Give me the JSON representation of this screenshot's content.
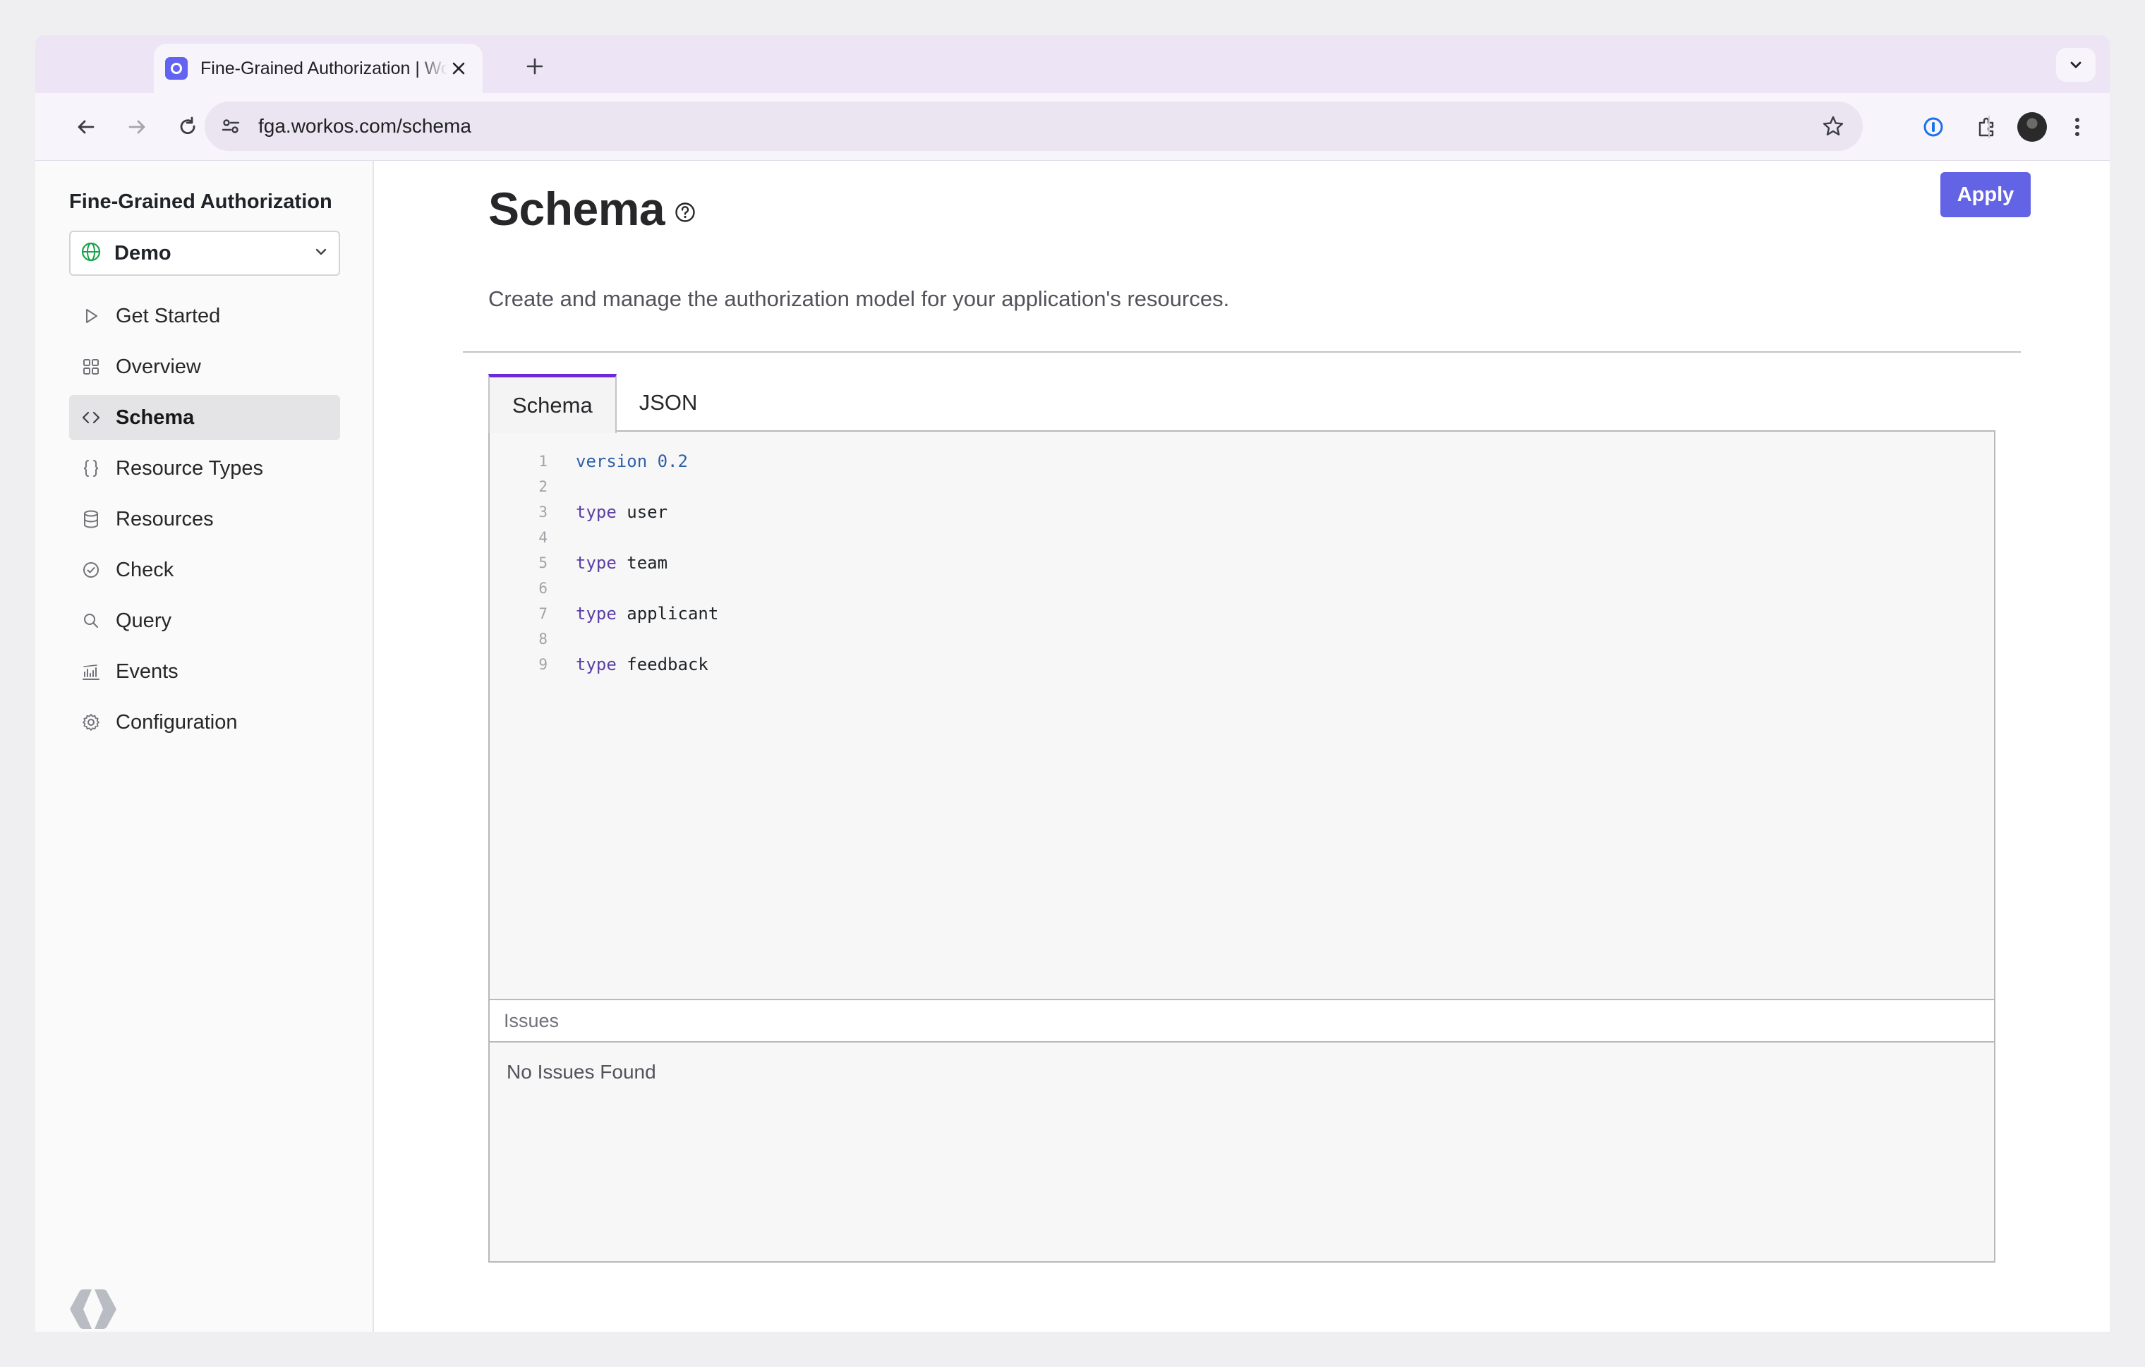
{
  "browser": {
    "tab_title": "Fine-Grained Authorization | WorkOS",
    "url": "fga.workos.com/schema"
  },
  "sidebar": {
    "app_title": "Fine-Grained Authorization",
    "environment": "Demo",
    "items": [
      {
        "label": "Get Started",
        "icon": "play-icon",
        "active": false
      },
      {
        "label": "Overview",
        "icon": "grid-icon",
        "active": false
      },
      {
        "label": "Schema",
        "icon": "code-icon",
        "active": true
      },
      {
        "label": "Resource Types",
        "icon": "braces-icon",
        "active": false
      },
      {
        "label": "Resources",
        "icon": "database-icon",
        "active": false
      },
      {
        "label": "Check",
        "icon": "check-circle-icon",
        "active": false
      },
      {
        "label": "Query",
        "icon": "search-icon",
        "active": false
      },
      {
        "label": "Events",
        "icon": "bar-chart-icon",
        "active": false
      },
      {
        "label": "Configuration",
        "icon": "gear-icon",
        "active": false
      }
    ]
  },
  "main": {
    "title": "Schema",
    "description": "Create and manage the authorization model for your application's resources.",
    "apply_label": "Apply",
    "tabs": [
      {
        "label": "Schema",
        "active": true
      },
      {
        "label": "JSON",
        "active": false
      }
    ],
    "code_lines": [
      {
        "n": "1",
        "keyword": "version",
        "value": "0.2"
      },
      {
        "n": "2",
        "keyword": "",
        "value": ""
      },
      {
        "n": "3",
        "keyword": "type",
        "value": "user"
      },
      {
        "n": "4",
        "keyword": "",
        "value": ""
      },
      {
        "n": "5",
        "keyword": "type",
        "value": "team"
      },
      {
        "n": "6",
        "keyword": "",
        "value": ""
      },
      {
        "n": "7",
        "keyword": "type",
        "value": "applicant"
      },
      {
        "n": "8",
        "keyword": "",
        "value": ""
      },
      {
        "n": "9",
        "keyword": "type",
        "value": "feedback"
      }
    ],
    "issues_label": "Issues",
    "issues_status": "No Issues Found"
  },
  "colors": {
    "accent": "#6363e6",
    "tab_indicator": "#6d28d9",
    "sidebar_active": "#e4e4e7"
  }
}
